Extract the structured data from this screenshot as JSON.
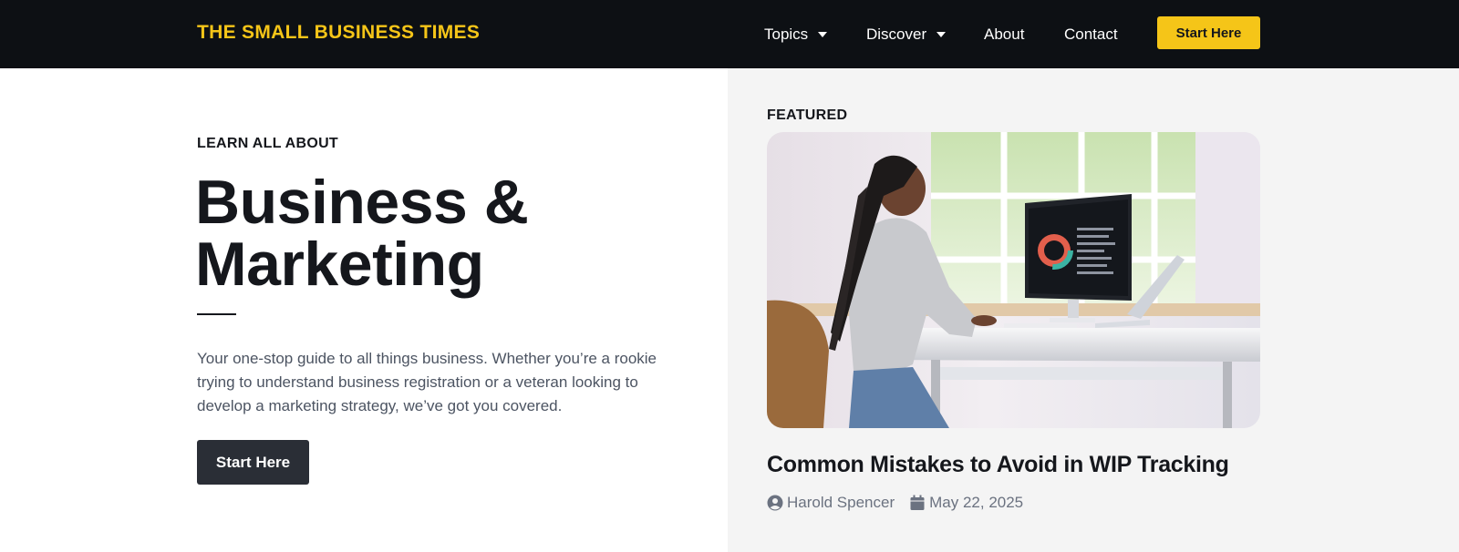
{
  "header": {
    "brand": "THE SMALL BUSINESS TIMES",
    "nav": [
      {
        "label": "Topics",
        "has_dropdown": true,
        "icon": "caret-down-icon"
      },
      {
        "label": "Discover",
        "has_dropdown": true,
        "icon": "caret-down-icon"
      },
      {
        "label": "About",
        "has_dropdown": false
      },
      {
        "label": "Contact",
        "has_dropdown": false
      }
    ],
    "cta_label": "Start Here"
  },
  "hero": {
    "eyebrow": "LEARN ALL ABOUT",
    "title_line1": "Business &",
    "title_line2": "Marketing",
    "description": "Your one-stop guide to all things business. Whether you’re a rookie trying to understand business registration or a veteran looking to develop a marketing strategy, we’ve got you covered.",
    "cta_label": "Start Here"
  },
  "featured": {
    "label": "FEATURED",
    "image_icon": "photo-woman-at-computer",
    "title": "Common Mistakes to Avoid in WIP Tracking",
    "author": "Harold Spencer",
    "author_icon": "user-circle-icon",
    "date": "May 22, 2025",
    "date_icon": "calendar-icon"
  },
  "colors": {
    "header_bg": "#0d1014",
    "brand": "#f5c518",
    "accent_button": "#f5c518",
    "hero_button": "#2a2e36",
    "panel_bg": "#f4f4f4",
    "muted_text": "#6b7280"
  }
}
